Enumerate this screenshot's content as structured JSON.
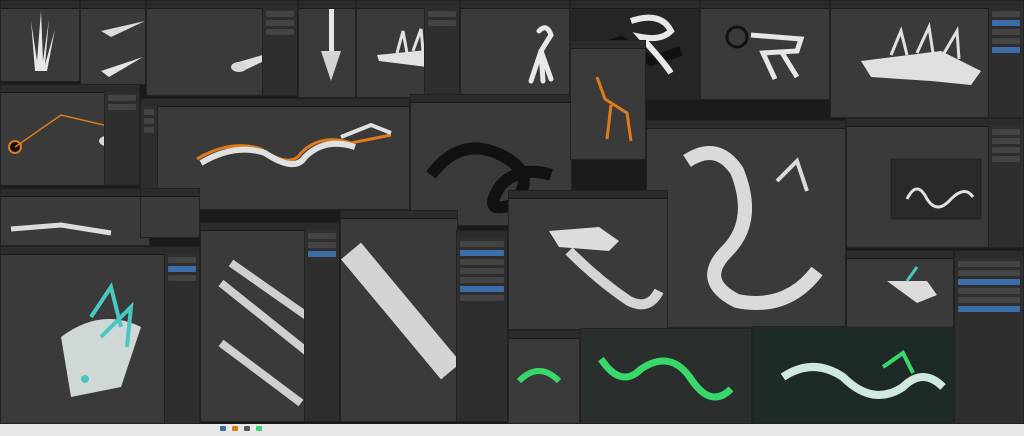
{
  "screen": {
    "kind": "collage of 3D modeling application screenshots",
    "subject_icon": "dragon-icon"
  },
  "colors": {
    "viewport": "#3a3a3a",
    "panel": "#2e2e2e",
    "selection": "#e07b1a",
    "accent_blue": "#3b6ea8",
    "glow_green": "#39d86a",
    "glow_teal": "#48c8c0",
    "taskbar": "#e8e8e8"
  },
  "tiles": [
    {
      "name": "spike-fan-tile"
    },
    {
      "name": "claw-tile"
    },
    {
      "name": "long-dragon-tile"
    },
    {
      "name": "head-closeup-tile"
    },
    {
      "name": "dark-wire-dragon-tile"
    },
    {
      "name": "orange-skeleton-tile"
    },
    {
      "name": "spiral-dragon-tile"
    },
    {
      "name": "glow-render-tile"
    },
    {
      "name": "stage-render-tile"
    }
  ]
}
